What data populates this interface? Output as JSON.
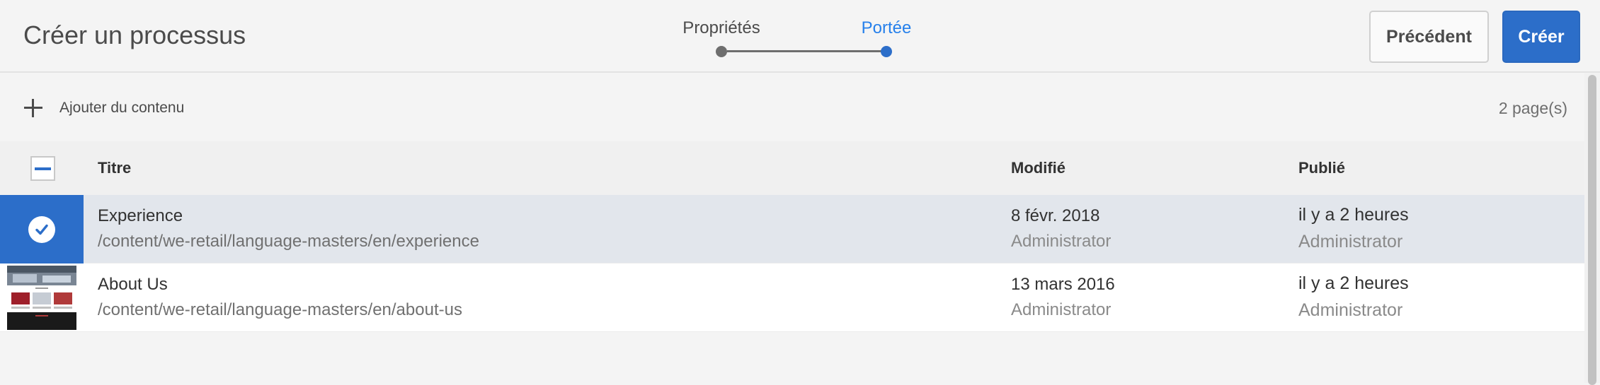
{
  "header": {
    "title": "Créer un processus",
    "steps": [
      {
        "label": "Propriétés",
        "state": "done"
      },
      {
        "label": "Portée",
        "state": "current"
      }
    ],
    "prev_label": "Précédent",
    "create_label": "Créer"
  },
  "actions": {
    "add_content_label": "Ajouter du contenu",
    "page_count": "2 page(s)"
  },
  "table": {
    "columns": {
      "title": "Titre",
      "modified": "Modifié",
      "published": "Publié"
    },
    "select_all_state": "indeterminate",
    "rows": [
      {
        "selected": true,
        "title": "Experience",
        "path": "/content/we-retail/language-masters/en/experience",
        "modified_date": "8 févr. 2018",
        "modified_by": "Administrator",
        "published_time": "il y a 2 heures",
        "published_by": "Administrator"
      },
      {
        "selected": false,
        "thumbnail": "page-thumbnail",
        "title": "About Us",
        "path": "/content/we-retail/language-masters/en/about-us",
        "modified_date": "13 mars 2016",
        "modified_by": "Administrator",
        "published_time": "il y a 2 heures",
        "published_by": "Administrator"
      }
    ]
  },
  "colors": {
    "accent": "#2c6ec9",
    "current_step": "#2680eb",
    "selected_row": "#e2e6ec"
  }
}
